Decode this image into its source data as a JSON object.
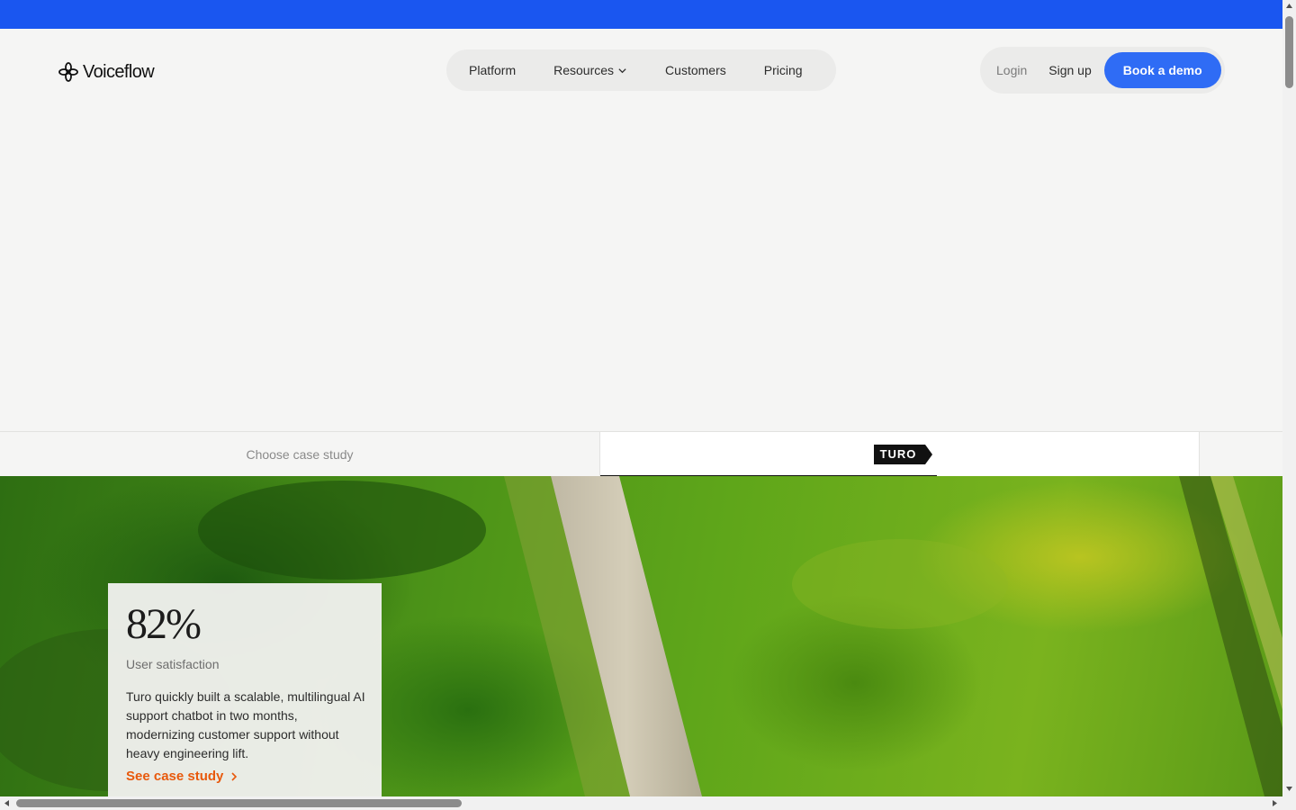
{
  "brand": {
    "name": "Voiceflow"
  },
  "nav": {
    "links": [
      {
        "label": "Platform"
      },
      {
        "label": "Resources"
      },
      {
        "label": "Customers"
      },
      {
        "label": "Pricing"
      }
    ]
  },
  "auth": {
    "login_label": "Login",
    "signup_label": "Sign up",
    "demo_label": "Book a demo"
  },
  "case_study_bar": {
    "choose_label": "Choose case study",
    "selected_logo": "TURO"
  },
  "stat_card": {
    "value": "82%",
    "label": "User satisfaction",
    "description": "Turo quickly built a scalable, multilingual AI support chatbot in two months, modernizing customer support without heavy engineering lift.",
    "link_label": "See case study"
  },
  "colors": {
    "banner": "#1a56f0",
    "primary_button": "#2f6cf5",
    "link_accent": "#e8590c"
  }
}
